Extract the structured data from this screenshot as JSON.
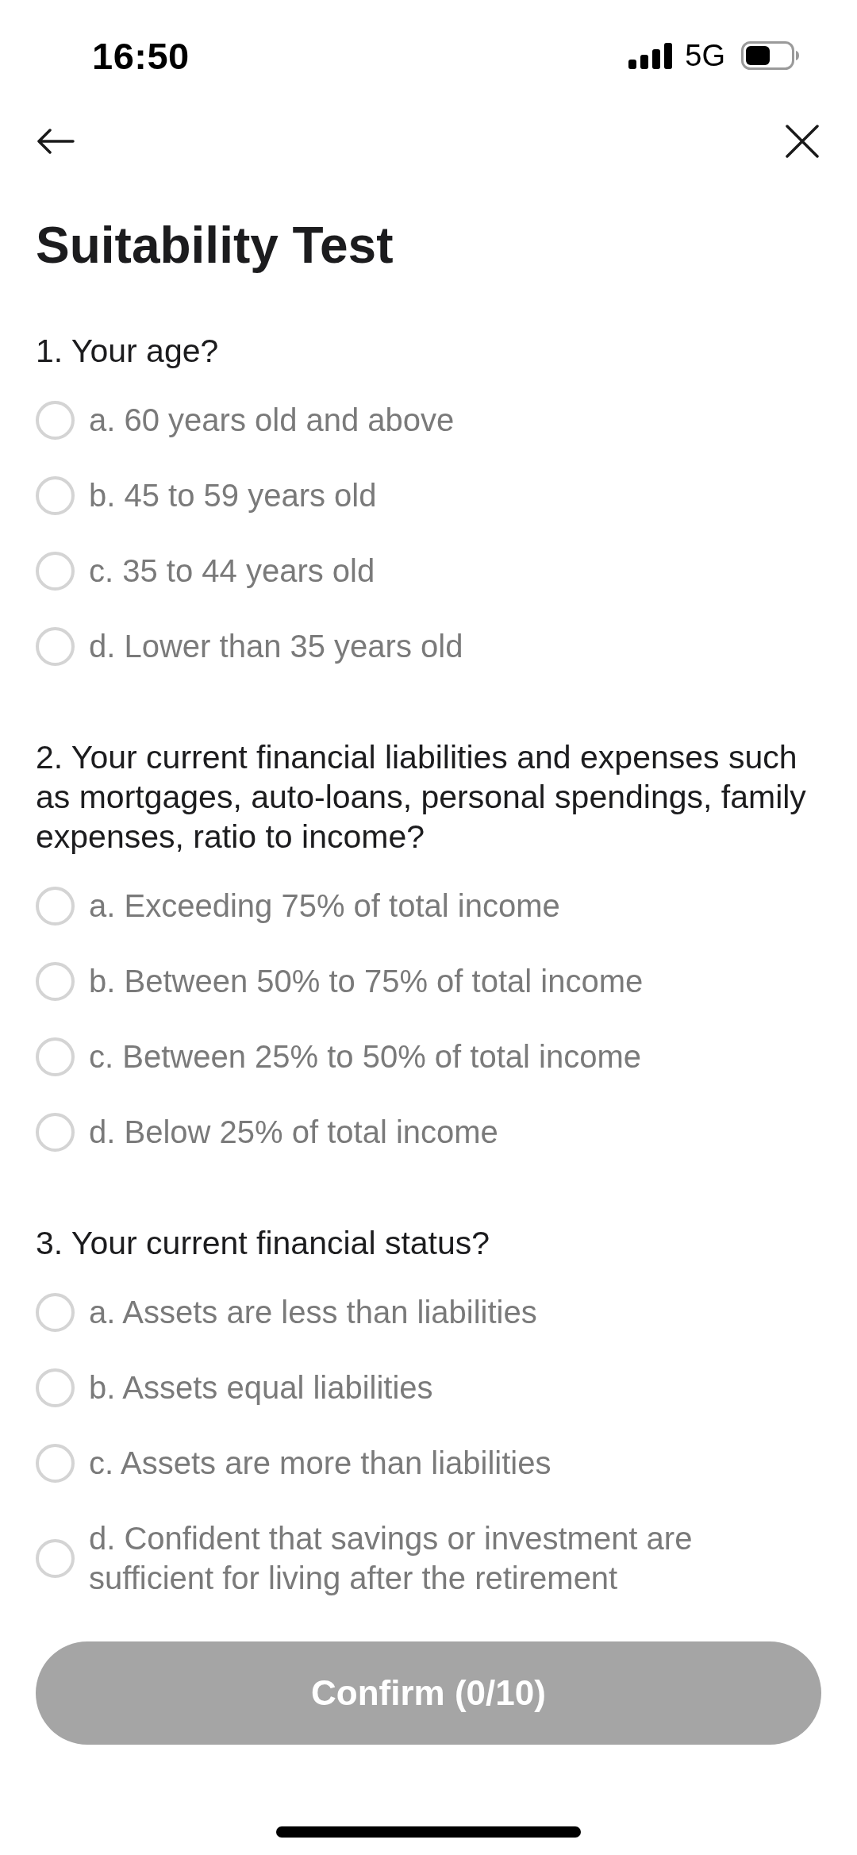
{
  "status_bar": {
    "time": "16:50",
    "network": "5G"
  },
  "header": {
    "title": "Suitability Test"
  },
  "questions": [
    {
      "text": "1. Your age?",
      "options": [
        {
          "label": "a. 60 years old and above",
          "selected": false
        },
        {
          "label": "b. 45 to 59 years old",
          "selected": false
        },
        {
          "label": "c. 35 to 44 years old",
          "selected": false
        },
        {
          "label": "d. Lower than 35 years old",
          "selected": false
        }
      ]
    },
    {
      "text": "2. Your current financial liabilities and expenses such as mortgages, auto-loans, personal spendings, family expenses, ratio to income?",
      "options": [
        {
          "label": "a. Exceeding 75% of total income",
          "selected": false
        },
        {
          "label": "b. Between 50% to 75% of total income",
          "selected": false
        },
        {
          "label": "c. Between 25% to 50% of total income",
          "selected": false
        },
        {
          "label": "d. Below 25% of total income",
          "selected": false
        }
      ]
    },
    {
      "text": "3. Your current financial status?",
      "options": [
        {
          "label": "a. Assets are less than liabilities",
          "selected": false
        },
        {
          "label": "b. Assets equal liabilities",
          "selected": false
        },
        {
          "label": "c. Assets are more than liabilities",
          "selected": false
        },
        {
          "label": "d. Confident that savings or investment are sufficient for living after the retirement",
          "selected": false
        }
      ]
    }
  ],
  "confirm_button": {
    "label": "Confirm (0/10)",
    "disabled": true
  }
}
